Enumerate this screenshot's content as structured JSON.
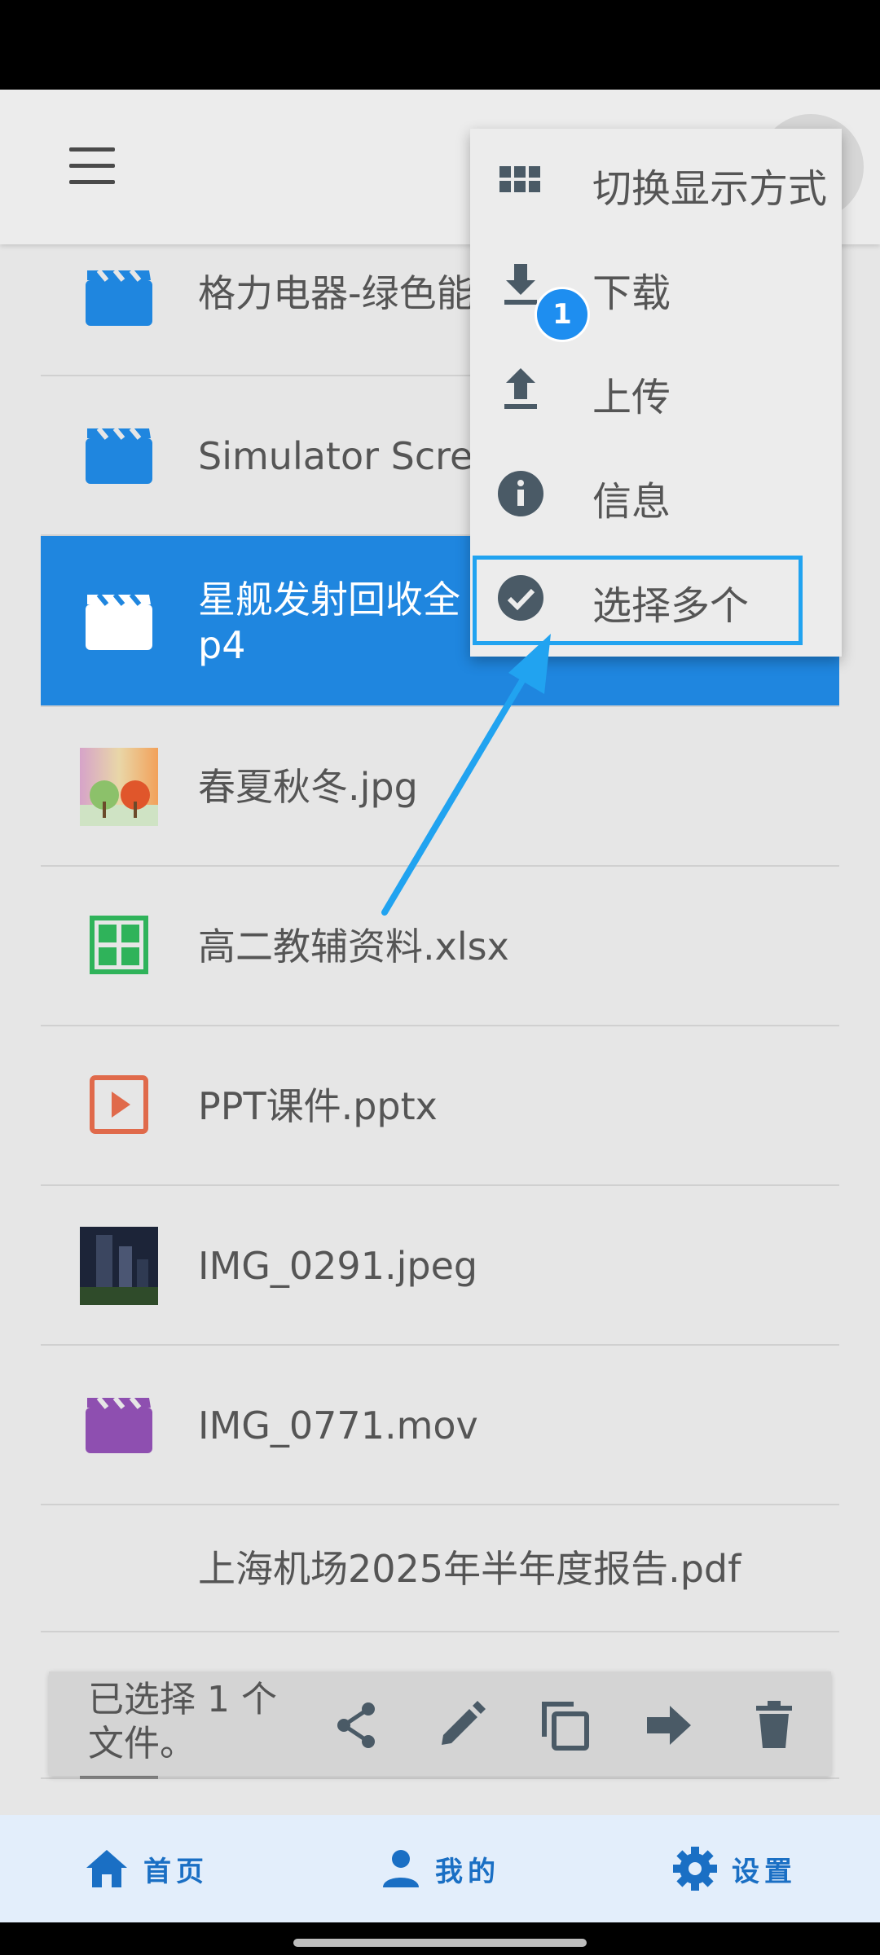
{
  "menu": {
    "items": [
      {
        "label": "切换显示方式",
        "icon": "grid-icon"
      },
      {
        "label": "下载",
        "icon": "download-icon"
      },
      {
        "label": "上传",
        "icon": "upload-icon"
      },
      {
        "label": "信息",
        "icon": "info-icon"
      },
      {
        "label": "选择多个",
        "icon": "check-circle-icon"
      }
    ],
    "step_badge": "1"
  },
  "files": [
    {
      "name": "格力电器-绿色能",
      "type": "video",
      "color": "#1f86df"
    },
    {
      "name": "Simulator Scree",
      "type": "video",
      "color": "#1f86df"
    },
    {
      "name": "星舰发射回收全\np4",
      "type": "video",
      "selected": true
    },
    {
      "name": "春夏秋冬.jpg",
      "type": "image"
    },
    {
      "name": "高二教辅资料.xlsx",
      "type": "spreadsheet",
      "color": "#2fb35a"
    },
    {
      "name": "PPT课件.pptx",
      "type": "presentation",
      "color": "#e06a4b"
    },
    {
      "name": "IMG_0291.jpeg",
      "type": "image"
    },
    {
      "name": "IMG_0771.mov",
      "type": "video",
      "color": "#8e4fb0"
    },
    {
      "name": "上海机场2025年半年度报告.pdf",
      "type": "pdf"
    }
  ],
  "selection": {
    "text": "已选择 1 个\n文件。",
    "actions": [
      "share-icon",
      "edit-icon",
      "copy-icon",
      "move-icon",
      "delete-icon"
    ]
  },
  "bottom_nav": [
    {
      "label": "首页",
      "icon": "home-icon"
    },
    {
      "label": "我的",
      "icon": "person-icon"
    },
    {
      "label": "设置",
      "icon": "gear-icon"
    }
  ],
  "colors": {
    "accent": "#1f86df",
    "highlight": "#21a3f0",
    "nav": "#1a6fc4"
  }
}
